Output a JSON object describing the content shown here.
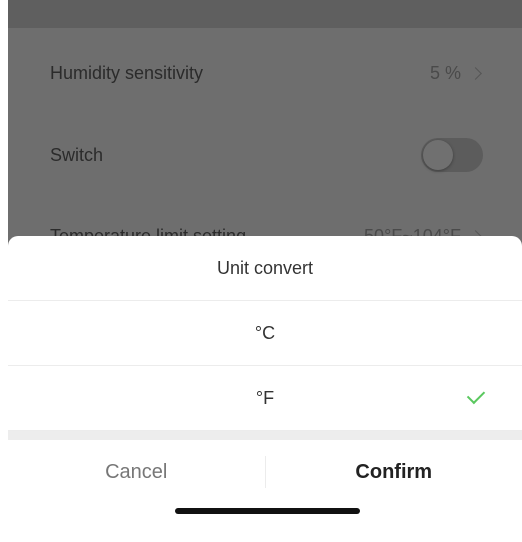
{
  "background_rows": [
    {
      "label": "Humidity sensitivity",
      "value": "5 %"
    },
    {
      "label": "Switch",
      "value": ""
    },
    {
      "label": "Temperature limit setting",
      "value": "50°F~104°F"
    }
  ],
  "switch_on": false,
  "sheet": {
    "title": "Unit convert",
    "options": [
      {
        "label": "°C",
        "selected": false
      },
      {
        "label": "°F",
        "selected": true
      }
    ],
    "cancel_label": "Cancel",
    "confirm_label": "Confirm"
  },
  "colors": {
    "overlay": "#6e6e6e",
    "check": "#5ac85f",
    "confirm_text": "#222222",
    "cancel_text": "#777777"
  }
}
